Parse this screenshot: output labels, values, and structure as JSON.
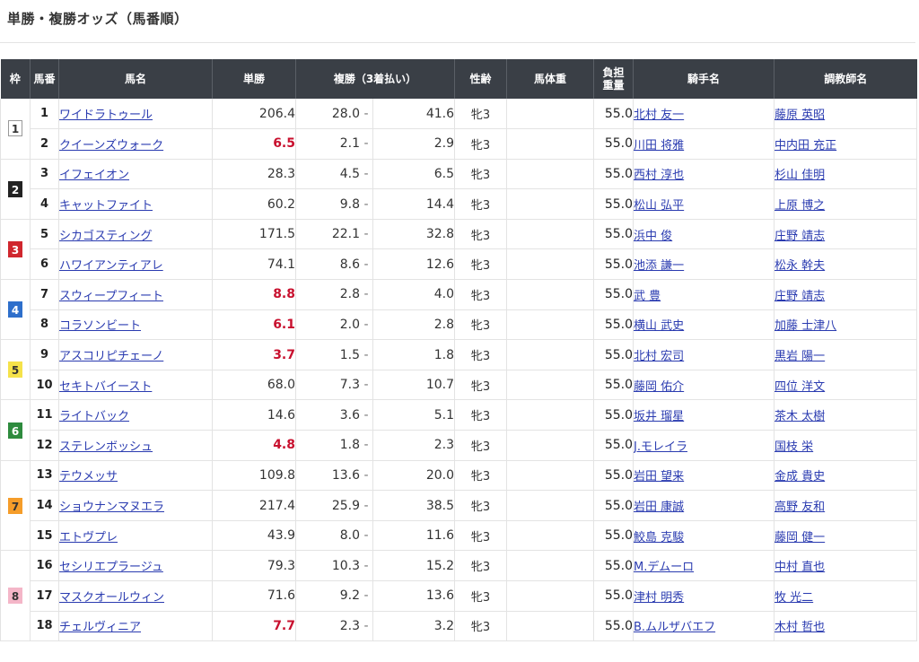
{
  "page": {
    "title": "単勝・複勝オッズ（馬番順）"
  },
  "table": {
    "headers": {
      "waku": "枠",
      "umaban": "馬番",
      "name": "馬名",
      "tan": "単勝",
      "fuku": "複勝（3着払い）",
      "sex": "性齢",
      "body": "馬体重",
      "burden_1": "負担",
      "burden_2": "重量",
      "jockey": "騎手名",
      "trainer": "調教師名"
    },
    "waku_groups": [
      {
        "num": "1",
        "rows": 2,
        "bg": "#ffffff",
        "fg": "#333333",
        "border": "#999999"
      },
      {
        "num": "2",
        "rows": 2,
        "bg": "#222222",
        "fg": "#ffffff",
        "border": "#222222"
      },
      {
        "num": "3",
        "rows": 2,
        "bg": "#d0272e",
        "fg": "#ffffff",
        "border": "#d0272e"
      },
      {
        "num": "4",
        "rows": 2,
        "bg": "#2e6fcb",
        "fg": "#ffffff",
        "border": "#2e6fcb"
      },
      {
        "num": "5",
        "rows": 2,
        "bg": "#f5e24a",
        "fg": "#333333",
        "border": "#f5e24a"
      },
      {
        "num": "6",
        "rows": 2,
        "bg": "#2e8b3e",
        "fg": "#ffffff",
        "border": "#2e8b3e"
      },
      {
        "num": "7",
        "rows": 3,
        "bg": "#f59d2a",
        "fg": "#333333",
        "border": "#f59d2a"
      },
      {
        "num": "8",
        "rows": 3,
        "bg": "#f4b6c8",
        "fg": "#333333",
        "border": "#f4b6c8"
      }
    ],
    "dash": "-",
    "rows": [
      {
        "umaban": "1",
        "name": "ワイドラトゥール",
        "tan": "206.4",
        "popular": false,
        "fuku_low": "28.0",
        "fuku_high": "41.6",
        "sex": "牝3",
        "body": "",
        "weight": "55.0",
        "jockey": "北村 友一",
        "trainer": "藤原 英昭"
      },
      {
        "umaban": "2",
        "name": "クイーンズウォーク",
        "tan": "6.5",
        "popular": true,
        "fuku_low": "2.1",
        "fuku_high": "2.9",
        "sex": "牝3",
        "body": "",
        "weight": "55.0",
        "jockey": "川田 将雅",
        "trainer": "中内田 充正"
      },
      {
        "umaban": "3",
        "name": "イフェイオン",
        "tan": "28.3",
        "popular": false,
        "fuku_low": "4.5",
        "fuku_high": "6.5",
        "sex": "牝3",
        "body": "",
        "weight": "55.0",
        "jockey": "西村 淳也",
        "trainer": "杉山 佳明"
      },
      {
        "umaban": "4",
        "name": "キャットファイト",
        "tan": "60.2",
        "popular": false,
        "fuku_low": "9.8",
        "fuku_high": "14.4",
        "sex": "牝3",
        "body": "",
        "weight": "55.0",
        "jockey": "松山 弘平",
        "trainer": "上原 博之"
      },
      {
        "umaban": "5",
        "name": "シカゴスティング",
        "tan": "171.5",
        "popular": false,
        "fuku_low": "22.1",
        "fuku_high": "32.8",
        "sex": "牝3",
        "body": "",
        "weight": "55.0",
        "jockey": "浜中 俊",
        "trainer": "庄野 靖志"
      },
      {
        "umaban": "6",
        "name": "ハワイアンティアレ",
        "tan": "74.1",
        "popular": false,
        "fuku_low": "8.6",
        "fuku_high": "12.6",
        "sex": "牝3",
        "body": "",
        "weight": "55.0",
        "jockey": "池添 謙一",
        "trainer": "松永 幹夫"
      },
      {
        "umaban": "7",
        "name": "スウィープフィート",
        "tan": "8.8",
        "popular": true,
        "fuku_low": "2.8",
        "fuku_high": "4.0",
        "sex": "牝3",
        "body": "",
        "weight": "55.0",
        "jockey": "武 豊",
        "trainer": "庄野 靖志"
      },
      {
        "umaban": "8",
        "name": "コラソンビート",
        "tan": "6.1",
        "popular": true,
        "fuku_low": "2.0",
        "fuku_high": "2.8",
        "sex": "牝3",
        "body": "",
        "weight": "55.0",
        "jockey": "横山 武史",
        "trainer": "加藤 士津八"
      },
      {
        "umaban": "9",
        "name": "アスコリピチェーノ",
        "tan": "3.7",
        "popular": true,
        "fuku_low": "1.5",
        "fuku_high": "1.8",
        "sex": "牝3",
        "body": "",
        "weight": "55.0",
        "jockey": "北村 宏司",
        "trainer": "黒岩 陽一"
      },
      {
        "umaban": "10",
        "name": "セキトバイースト",
        "tan": "68.0",
        "popular": false,
        "fuku_low": "7.3",
        "fuku_high": "10.7",
        "sex": "牝3",
        "body": "",
        "weight": "55.0",
        "jockey": "藤岡 佑介",
        "trainer": "四位 洋文"
      },
      {
        "umaban": "11",
        "name": "ライトバック",
        "tan": "14.6",
        "popular": false,
        "fuku_low": "3.6",
        "fuku_high": "5.1",
        "sex": "牝3",
        "body": "",
        "weight": "55.0",
        "jockey": "坂井 瑠星",
        "trainer": "茶木 太樹"
      },
      {
        "umaban": "12",
        "name": "ステレンボッシュ",
        "tan": "4.8",
        "popular": true,
        "fuku_low": "1.8",
        "fuku_high": "2.3",
        "sex": "牝3",
        "body": "",
        "weight": "55.0",
        "jockey": "J.モレイラ",
        "trainer": "国枝 栄"
      },
      {
        "umaban": "13",
        "name": "テウメッサ",
        "tan": "109.8",
        "popular": false,
        "fuku_low": "13.6",
        "fuku_high": "20.0",
        "sex": "牝3",
        "body": "",
        "weight": "55.0",
        "jockey": "岩田 望来",
        "trainer": "金成 貴史"
      },
      {
        "umaban": "14",
        "name": "ショウナンマヌエラ",
        "tan": "217.4",
        "popular": false,
        "fuku_low": "25.9",
        "fuku_high": "38.5",
        "sex": "牝3",
        "body": "",
        "weight": "55.0",
        "jockey": "岩田 康誠",
        "trainer": "高野 友和"
      },
      {
        "umaban": "15",
        "name": "エトヴプレ",
        "tan": "43.9",
        "popular": false,
        "fuku_low": "8.0",
        "fuku_high": "11.6",
        "sex": "牝3",
        "body": "",
        "weight": "55.0",
        "jockey": "鮫島 克駿",
        "trainer": "藤岡 健一"
      },
      {
        "umaban": "16",
        "name": "セシリエプラージュ",
        "tan": "79.3",
        "popular": false,
        "fuku_low": "10.3",
        "fuku_high": "15.2",
        "sex": "牝3",
        "body": "",
        "weight": "55.0",
        "jockey": "M.デムーロ",
        "trainer": "中村 直也"
      },
      {
        "umaban": "17",
        "name": "マスクオールウィン",
        "tan": "71.6",
        "popular": false,
        "fuku_low": "9.2",
        "fuku_high": "13.6",
        "sex": "牝3",
        "body": "",
        "weight": "55.0",
        "jockey": "津村 明秀",
        "trainer": "牧 光二"
      },
      {
        "umaban": "18",
        "name": "チェルヴィニア",
        "tan": "7.7",
        "popular": true,
        "fuku_low": "2.3",
        "fuku_high": "3.2",
        "sex": "牝3",
        "body": "",
        "weight": "55.0",
        "jockey": "B.ムルザバエフ",
        "trainer": "木村 哲也"
      }
    ]
  }
}
